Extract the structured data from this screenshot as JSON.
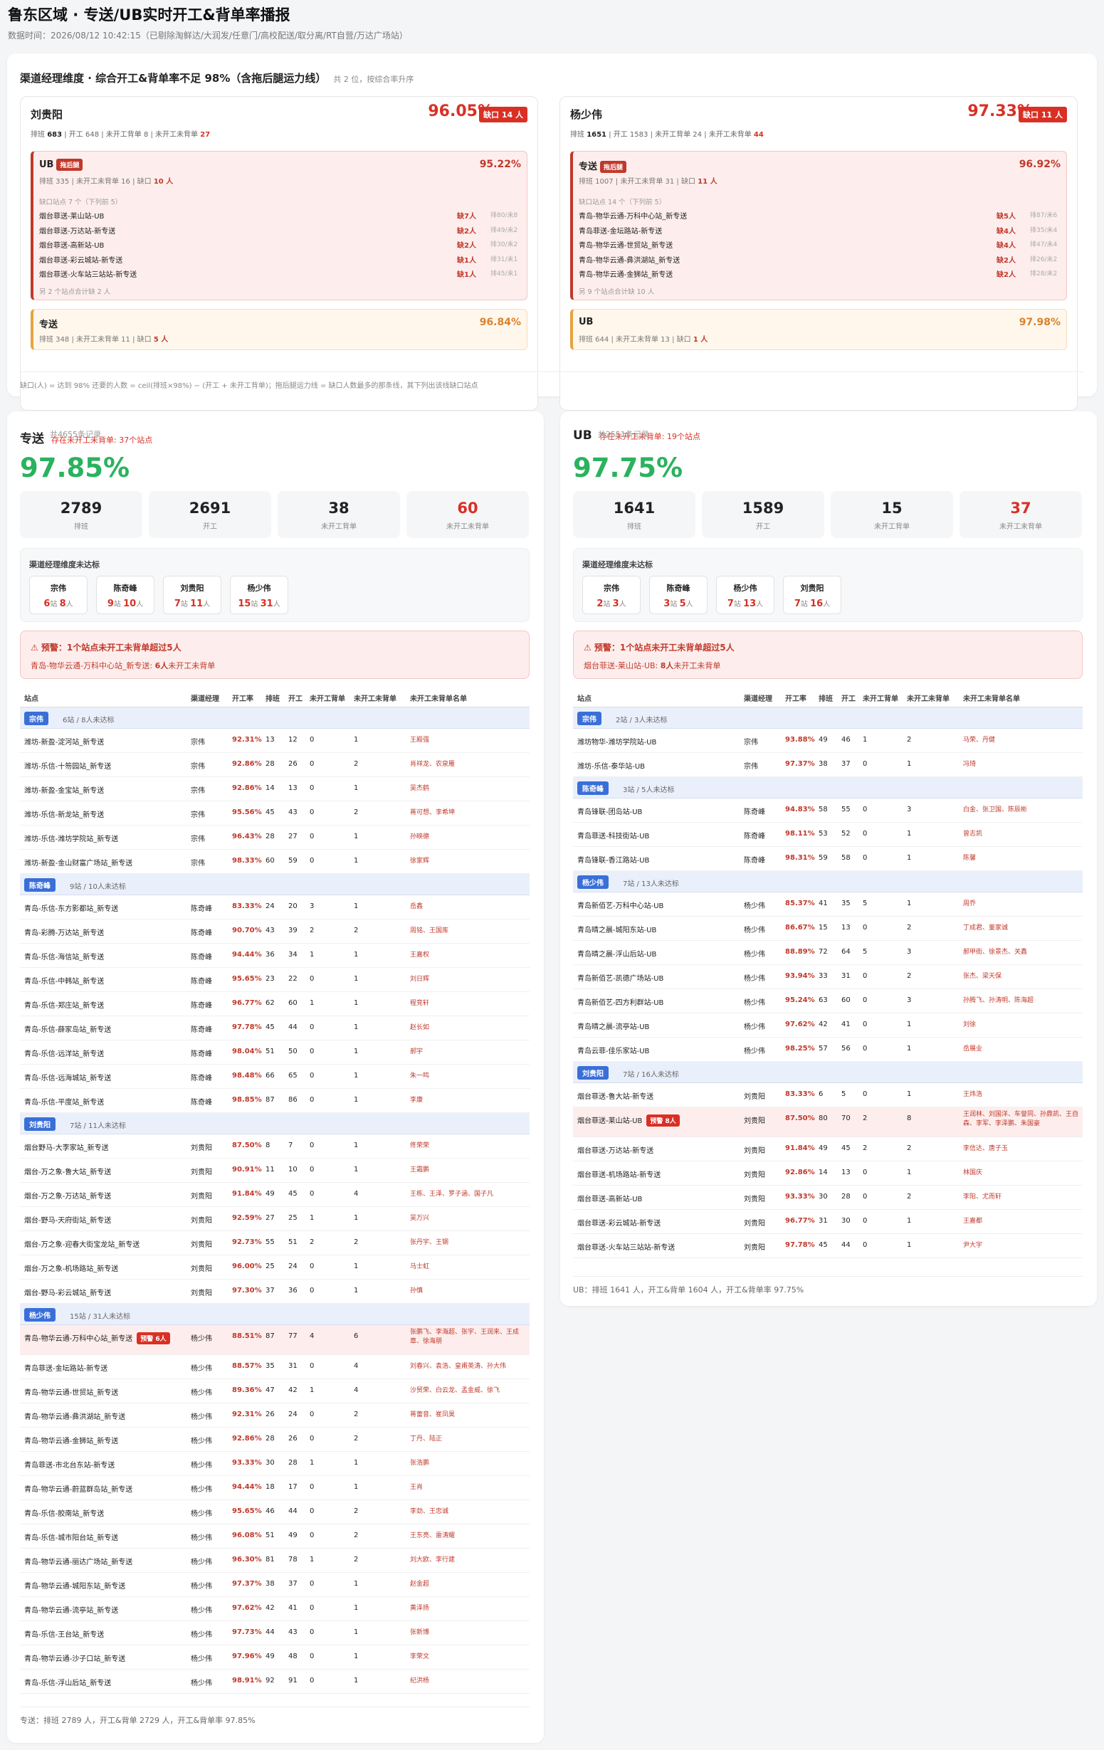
{
  "header": {
    "title": "鲁东区域 · 专送/UB实时开工&背单率播报",
    "subtitle": "数据时间：2026/08/12 10:42:15（已剔除淘鲜达/大润发/任意门/高校配送/取分离/RT自营/万达广场站）"
  },
  "summary": {
    "title": "渠道经理维度 · 综合开工&背单率不足 98%（含拖后腿运力线）",
    "count": "共 2 位，按综合率升序",
    "note": "缺口(人) = 达到 98% 还要的人数 = ceil(排班×98%) − (开工 + 未开工背单)；拖后腿运力线 = 缺口人数最多的那条线，其下列出该线缺口站点",
    "managers": [
      {
        "name": "刘贵阳",
        "rate": "96.05%",
        "gap": "缺口 14 人",
        "meta": {
          "a": "排班 ",
          "av": "683",
          "b": " | 开工 648 | 未开工背单 8 | 未开工未背单 ",
          "bv": "27"
        },
        "bad": {
          "name": "UB",
          "tag": "拖后腿",
          "rate": "95.22%",
          "meta": "排班 335 | 未开工未背单 16 | 缺口 ",
          "gap": "10 人",
          "sites_title": "缺口站点 7 个（下列前 5）",
          "sites": [
            {
              "n": "烟台菲送-莱山站-UB",
              "g": "缺7人",
              "x": "排80/未8"
            },
            {
              "n": "烟台菲送-万达站-新专送",
              "g": "缺2人",
              "x": "排49/未2"
            },
            {
              "n": "烟台菲送-高新站-UB",
              "g": "缺2人",
              "x": "排30/未2"
            },
            {
              "n": "烟台菲送-彩云城站-新专送",
              "g": "缺1人",
              "x": "排31/未1"
            },
            {
              "n": "烟台菲送-火车站三站站-新专送",
              "g": "缺1人",
              "x": "排45/未1"
            }
          ],
          "more": "另 2 个站点合计缺 2 人"
        },
        "ok": {
          "name": "专送",
          "rate": "96.84%",
          "meta": "排班 348 | 未开工未背单 11 | 缺口 ",
          "gap": "5 人"
        }
      },
      {
        "name": "杨少伟",
        "rate": "97.33%",
        "gap": "缺口 11 人",
        "meta": {
          "a": "排班 ",
          "av": "1651",
          "b": " | 开工 1583 | 未开工背单 24 | 未开工未背单 ",
          "bv": "44"
        },
        "bad": {
          "name": "专送",
          "tag": "拖后腿",
          "rate": "96.92%",
          "meta": "排班 1007 | 未开工未背单 31 | 缺口 ",
          "gap": "11 人",
          "sites_title": "缺口站点 14 个（下列前 5）",
          "sites": [
            {
              "n": "青岛-物华云通-万科中心站_新专送",
              "g": "缺5人",
              "x": "排87/未6"
            },
            {
              "n": "青岛菲送-金坛路站-新专送",
              "g": "缺4人",
              "x": "排35/未4"
            },
            {
              "n": "青岛-物华云通-世贸站_新专送",
              "g": "缺4人",
              "x": "排47/未4"
            },
            {
              "n": "青岛-物华云通-彝洪湖站_新专送",
              "g": "缺2人",
              "x": "排26/未2"
            },
            {
              "n": "青岛-物华云通-金狮站_新专送",
              "g": "缺2人",
              "x": "排28/未2"
            }
          ],
          "more": "另 9 个站点合计缺 10 人"
        },
        "ok": {
          "name": "UB",
          "rate": "97.98%",
          "meta": "排班 644 | 未开工未背单 13 | 缺口 ",
          "gap": "1 人"
        }
      }
    ]
  },
  "left": {
    "title": "专送",
    "count": "共4655条记录",
    "warn": "存在未开工未背单: 37个站点",
    "rate": "97.85%",
    "stats": [
      {
        "v": "2789",
        "l": "排班"
      },
      {
        "v": "2691",
        "l": "开工"
      },
      {
        "v": "38",
        "l": "未开工背单"
      },
      {
        "v": "60",
        "l": "未开工未背单"
      }
    ],
    "mgr_title": "渠道经理维度未达标",
    "chips": [
      {
        "n": "宗伟",
        "s": "6",
        "p": "8"
      },
      {
        "n": "陈奇峰",
        "s": "9",
        "p": "10"
      },
      {
        "n": "刘贵阳",
        "s": "7",
        "p": "11"
      },
      {
        "n": "杨少伟",
        "s": "15",
        "p": "31"
      }
    ],
    "alert_title": "⚠ 预警：1个站点未开工未背单超过5人",
    "alert_site": "青岛-物华云通-万科中心站_新专送: ",
    "alert_num": "6人",
    "alert_tail": "未开工未背单",
    "footer": "专送：排班 2789 人，开工&背单 2729 人，开工&背单率 97.85%"
  },
  "right": {
    "title": "UB",
    "count": "共2551条记录",
    "warn": "存在未开工未背单: 19个站点",
    "rate": "97.75%",
    "stats": [
      {
        "v": "1641",
        "l": "排班"
      },
      {
        "v": "1589",
        "l": "开工"
      },
      {
        "v": "15",
        "l": "未开工背单"
      },
      {
        "v": "37",
        "l": "未开工未背单"
      }
    ],
    "mgr_title": "渠道经理维度未达标",
    "chips": [
      {
        "n": "宗伟",
        "s": "2",
        "p": "3"
      },
      {
        "n": "陈奇峰",
        "s": "3",
        "p": "5"
      },
      {
        "n": "杨少伟",
        "s": "7",
        "p": "13"
      },
      {
        "n": "刘贵阳",
        "s": "7",
        "p": "16"
      }
    ],
    "alert_title": "⚠ 预警：1个站点未开工未背单超过5人",
    "alert_site": "烟台菲送-莱山站-UB: ",
    "alert_num": "8人",
    "alert_tail": "未开工未背单",
    "footer": "UB：排班 1641 人，开工&背单 1604 人，开工&背单率 97.75%"
  },
  "chip_units": {
    "s": "站",
    "p": "人"
  },
  "table_headers": [
    "站点",
    "渠道经理",
    "开工率",
    "排班",
    "开工",
    "未开工背单",
    "未开工未背单",
    "未开工未背单名单"
  ],
  "left_table": [
    {
      "g": "宗伟",
      "gi": "6站 / 8人未达标",
      "rows": [
        [
          "潍坊-新盈-淀河站_新专送",
          "宗伟",
          "92.31%",
          "13",
          "12",
          "0",
          "1",
          "王殿强"
        ],
        [
          "潍坊-乐信-十笏园站_新专送",
          "宗伟",
          "92.86%",
          "28",
          "26",
          "0",
          "2",
          "肖祥龙、农泉雁"
        ],
        [
          "潍坊-新盈-金宝站_新专送",
          "宗伟",
          "92.86%",
          "14",
          "13",
          "0",
          "1",
          "吴杰鹤"
        ],
        [
          "潍坊-乐信-新龙站_新专送",
          "宗伟",
          "95.56%",
          "45",
          "43",
          "0",
          "2",
          "蒋可想、李希坤"
        ],
        [
          "潍坊-乐信-潍坊学院站_新专送",
          "宗伟",
          "96.43%",
          "28",
          "27",
          "0",
          "1",
          "孙映德"
        ],
        [
          "潍坊-新盈-金山财富广场站_新专送",
          "宗伟",
          "98.33%",
          "60",
          "59",
          "0",
          "1",
          "徐家辉"
        ]
      ]
    },
    {
      "g": "陈奇峰",
      "gi": "9站 / 10人未达标",
      "rows": [
        [
          "青岛-乐信-东方影都站_新专送",
          "陈奇峰",
          "83.33%",
          "24",
          "20",
          "3",
          "1",
          "岳鑫"
        ],
        [
          "青岛-彩腾-万达站_新专送",
          "陈奇峰",
          "90.70%",
          "43",
          "39",
          "2",
          "2",
          "周铭、王国库"
        ],
        [
          "青岛-乐信-海信站_新专送",
          "陈奇峰",
          "94.44%",
          "36",
          "34",
          "1",
          "1",
          "王嘉权"
        ],
        [
          "青岛-乐信-中韩站_新专送",
          "陈奇峰",
          "95.65%",
          "23",
          "22",
          "0",
          "1",
          "刘日辉"
        ],
        [
          "青岛-乐信-郑庄站_新专送",
          "陈奇峰",
          "96.77%",
          "62",
          "60",
          "1",
          "1",
          "程竞轩"
        ],
        [
          "青岛-乐信-薛家岛站_新专送",
          "陈奇峰",
          "97.78%",
          "45",
          "44",
          "0",
          "1",
          "赵长如"
        ],
        [
          "青岛-乐信-远洋站_新专送",
          "陈奇峰",
          "98.04%",
          "51",
          "50",
          "0",
          "1",
          "郝宇"
        ],
        [
          "青岛-乐信-远海城站_新专送",
          "陈奇峰",
          "98.48%",
          "66",
          "65",
          "0",
          "1",
          "朱一鸣"
        ],
        [
          "青岛-乐信-平度站_新专送",
          "陈奇峰",
          "98.85%",
          "87",
          "86",
          "0",
          "1",
          "李康"
        ]
      ]
    },
    {
      "g": "刘贵阳",
      "gi": "7站 / 11人未达标",
      "rows": [
        [
          "烟台野马-大李家站_新专送",
          "刘贵阳",
          "87.50%",
          "8",
          "7",
          "0",
          "1",
          "佟荣荣"
        ],
        [
          "烟台-万之象-鲁大站_新专送",
          "刘贵阳",
          "90.91%",
          "11",
          "10",
          "0",
          "1",
          "王霜鹏"
        ],
        [
          "烟台-万之象-万达站_新专送",
          "刘贵阳",
          "91.84%",
          "49",
          "45",
          "0",
          "4",
          "王栋、王泽、罗子涵、国子凡"
        ],
        [
          "烟台-野马-天府街站_新专送",
          "刘贵阳",
          "92.59%",
          "27",
          "25",
          "1",
          "1",
          "吴万兴"
        ],
        [
          "烟台-万之象-迎春大街宝龙站_新专送",
          "刘贵阳",
          "92.73%",
          "55",
          "51",
          "2",
          "2",
          "张丹宇、王钢"
        ],
        [
          "烟台-万之象-机场路站_新专送",
          "刘贵阳",
          "96.00%",
          "25",
          "24",
          "0",
          "1",
          "马士虹"
        ],
        [
          "烟台-野马-彩云城站_新专送",
          "刘贵阳",
          "97.30%",
          "37",
          "36",
          "0",
          "1",
          "孙慎"
        ]
      ]
    },
    {
      "g": "杨少伟",
      "gi": "15站 / 31人未达标",
      "rows": [
        [
          "青岛-物华云通-万科中心站_新专送",
          "杨少伟",
          "88.51%",
          "87",
          "77",
          "4",
          "6",
          "张鹏飞、李海超、张宇、王润来、王成章、徐海朋",
          "预警 6人"
        ],
        [
          "青岛菲送-金坛路站-新专送",
          "杨少伟",
          "88.57%",
          "35",
          "31",
          "0",
          "4",
          "刘春兴、袁浩、皇甫英涛、孙大伟"
        ],
        [
          "青岛-物华云通-世贸站_新专送",
          "杨少伟",
          "89.36%",
          "47",
          "42",
          "1",
          "4",
          "沙贸荣、白云龙、孟金威、徐飞"
        ],
        [
          "青岛-物华云通-彝洪湖站_新专送",
          "杨少伟",
          "92.31%",
          "26",
          "24",
          "0",
          "2",
          "蒋蕾音、崔凤昊"
        ],
        [
          "青岛-物华云通-金狮站_新专送",
          "杨少伟",
          "92.86%",
          "28",
          "26",
          "0",
          "2",
          "丁丹、陆正"
        ],
        [
          "青岛菲送-市北台东站-新专送",
          "杨少伟",
          "93.33%",
          "30",
          "28",
          "1",
          "1",
          "张浩鹏"
        ],
        [
          "青岛-物华云通-蔚蓝群岛站_新专送",
          "杨少伟",
          "94.44%",
          "18",
          "17",
          "0",
          "1",
          "王肖"
        ],
        [
          "青岛-乐信-胶南站_新专送",
          "杨少伟",
          "95.65%",
          "46",
          "44",
          "0",
          "2",
          "李劲、王忠诚"
        ],
        [
          "青岛-乐信-城市阳台站_新专送",
          "杨少伟",
          "96.08%",
          "51",
          "49",
          "0",
          "2",
          "王东亮、雷涛耀"
        ],
        [
          "青岛-物华云通-丽达广场站_新专送",
          "杨少伟",
          "96.30%",
          "81",
          "78",
          "1",
          "2",
          "刘大欧、李行建"
        ],
        [
          "青岛-物华云通-城阳东站_新专送",
          "杨少伟",
          "97.37%",
          "38",
          "37",
          "0",
          "1",
          "赵金超"
        ],
        [
          "青岛-物华云通-流亭站_新专送",
          "杨少伟",
          "97.62%",
          "42",
          "41",
          "0",
          "1",
          "黄泽扬"
        ],
        [
          "青岛-乐信-王台站_新专送",
          "杨少伟",
          "97.73%",
          "44",
          "43",
          "0",
          "1",
          "张新博"
        ],
        [
          "青岛-物华云通-沙子口站_新专送",
          "杨少伟",
          "97.96%",
          "49",
          "48",
          "0",
          "1",
          "李荣文"
        ],
        [
          "青岛-乐信-浮山后站_新专送",
          "杨少伟",
          "98.91%",
          "92",
          "91",
          "0",
          "1",
          "纪洪杨"
        ]
      ]
    }
  ],
  "right_table": [
    {
      "g": "宗伟",
      "gi": "2站 / 3人未达标",
      "rows": [
        [
          "潍坊物华-潍坊学院站-UB",
          "宗伟",
          "93.88%",
          "49",
          "46",
          "1",
          "2",
          "马荣、丹健"
        ],
        [
          "潍坊-乐信-泰华站-UB",
          "宗伟",
          "97.37%",
          "38",
          "37",
          "0",
          "1",
          "冯琦"
        ]
      ]
    },
    {
      "g": "陈奇峰",
      "gi": "3站 / 5人未达标",
      "rows": [
        [
          "青岛锋联-团岛站-UB",
          "陈奇峰",
          "94.83%",
          "58",
          "55",
          "0",
          "3",
          "白金、张卫国、陈辰彬"
        ],
        [
          "青岛菲送-科技街站-UB",
          "陈奇峰",
          "98.11%",
          "53",
          "52",
          "0",
          "1",
          "曾志凯"
        ],
        [
          "青岛锋联-香江路站-UB",
          "陈奇峰",
          "98.31%",
          "59",
          "58",
          "0",
          "1",
          "陈馨"
        ]
      ]
    },
    {
      "g": "杨少伟",
      "gi": "7站 / 13人未达标",
      "rows": [
        [
          "青岛新佰艺-万科中心站-UB",
          "杨少伟",
          "85.37%",
          "41",
          "35",
          "5",
          "1",
          "周乔"
        ],
        [
          "青岛晴之晨-城阳东站-UB",
          "杨少伟",
          "86.67%",
          "15",
          "13",
          "0",
          "2",
          "丁成君、董家诚"
        ],
        [
          "青岛晴之晨-浮山后站-UB",
          "杨少伟",
          "88.89%",
          "72",
          "64",
          "5",
          "3",
          "郝甲街、徐景杰、关鑫"
        ],
        [
          "青岛新佰艺-凯德广场站-UB",
          "杨少伟",
          "93.94%",
          "33",
          "31",
          "0",
          "2",
          "张杰、梁天保"
        ],
        [
          "青岛新佰艺-四方利群站-UB",
          "杨少伟",
          "95.24%",
          "63",
          "60",
          "0",
          "3",
          "孙腾飞、孙涛明、陈海超"
        ],
        [
          "青岛晴之晨-流亭站-UB",
          "杨少伟",
          "97.62%",
          "42",
          "41",
          "0",
          "1",
          "刘徐"
        ],
        [
          "青岛云菲-佳乐家站-UB",
          "杨少伟",
          "98.25%",
          "57",
          "56",
          "0",
          "1",
          "岳展业"
        ]
      ]
    },
    {
      "g": "刘贵阳",
      "gi": "7站 / 16人未达标",
      "rows": [
        [
          "烟台菲送-鲁大站-新专送",
          "刘贵阳",
          "83.33%",
          "6",
          "5",
          "0",
          "1",
          "王炜浩"
        ],
        [
          "烟台菲送-莱山站-UB",
          "刘贵阳",
          "87.50%",
          "80",
          "70",
          "2",
          "8",
          "王润林、刘国洋、车誉同、孙鼎凯、王自森、李军、李泽鹏、朱国豪",
          "预警 8人"
        ],
        [
          "烟台菲送-万达站-新专送",
          "刘贵阳",
          "91.84%",
          "49",
          "45",
          "2",
          "2",
          "李信达、唐子玉"
        ],
        [
          "烟台菲送-机场路站-新专送",
          "刘贵阳",
          "92.86%",
          "14",
          "13",
          "0",
          "1",
          "林国庆"
        ],
        [
          "烟台菲送-高新站-UB",
          "刘贵阳",
          "93.33%",
          "30",
          "28",
          "0",
          "2",
          "李阳、尤而轩"
        ],
        [
          "烟台菲送-彩云城站-新专送",
          "刘贵阳",
          "96.77%",
          "31",
          "30",
          "0",
          "1",
          "王嘉都"
        ],
        [
          "烟台菲送-火车站三站站-新专送",
          "刘贵阳",
          "97.78%",
          "45",
          "44",
          "0",
          "1",
          "尹大宇"
        ]
      ]
    }
  ]
}
